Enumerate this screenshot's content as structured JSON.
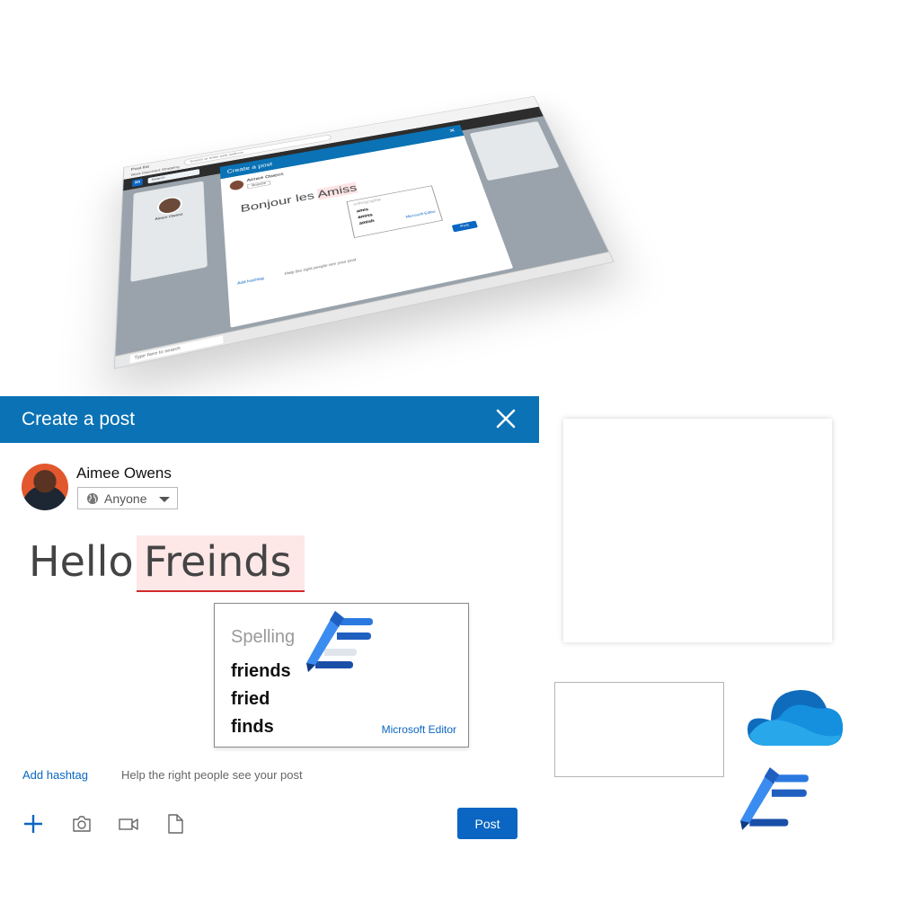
{
  "mockup": {
    "browser_tab": "Post list",
    "url": "Search or enter web address",
    "bookmarks": "Work   Important   Shopping",
    "search": "Search",
    "sidebar_name": "Aimee Owens",
    "dialog_title": "Create a post",
    "author": "Aimee Owens",
    "visibility": "Anyone",
    "text_plain": "Bonjour les ",
    "text_error": "Amiss",
    "popup_heading": "orthographe",
    "suggestions": [
      "amis",
      "amiss",
      "amish"
    ],
    "editor_label": "Microsoft Editor",
    "add_hashtag": "Add hashtag",
    "hashtag_help": "Help the right people see your post",
    "post": "Post",
    "taskbar_search": "Type here to search"
  },
  "dialog": {
    "title": "Create a post",
    "author_name": "Aimee Owens",
    "visibility": "Anyone",
    "text_plain": "Hello",
    "text_misspelled": "Freinds",
    "add_hashtag": "Add hashtag",
    "hashtag_help": "Help the right people see your post",
    "post_label": "Post"
  },
  "spelling_popup": {
    "heading": "Spelling",
    "suggestions": [
      "friends",
      "fried",
      "finds"
    ],
    "source": "Microsoft Editor"
  },
  "icons": {
    "close": "close-icon",
    "globe": "globe-icon",
    "caret": "chevron-down-icon",
    "plus": "plus-icon",
    "camera": "camera-icon",
    "video": "video-icon",
    "document": "document-icon",
    "editor": "microsoft-editor-icon",
    "onedrive": "onedrive-icon"
  },
  "colors": {
    "header_blue": "#0a72b5",
    "link_blue": "#0a66c2",
    "error_red": "#d12b2b",
    "error_bg": "#fde7e7"
  }
}
